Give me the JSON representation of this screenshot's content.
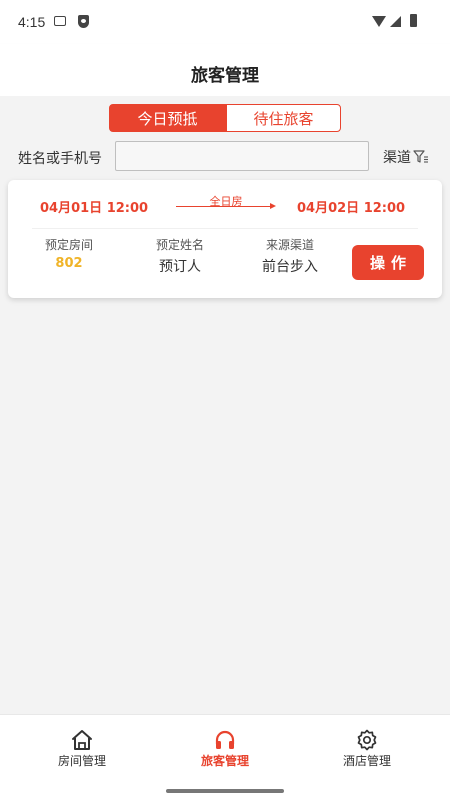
{
  "status_bar": {
    "time": "4:15"
  },
  "header": {
    "title": "旅客管理"
  },
  "tabs": [
    {
      "label": "今日预抵",
      "active": true
    },
    {
      "label": "待住旅客",
      "active": false
    }
  ],
  "search": {
    "label": "姓名或手机号",
    "value": "",
    "placeholder": ""
  },
  "filter": {
    "label": "渠道",
    "icon": "filter-icon"
  },
  "reservation": {
    "checkin": "04月01日 12:00",
    "checkout": "04月02日 12:00",
    "room_type": "全日房",
    "room_label": "预定房间",
    "room_number": "802",
    "name_label": "预定姓名",
    "name_value": "预订人",
    "source_label": "来源渠道",
    "source_value": "前台步入",
    "action_label": "操作"
  },
  "nav": [
    {
      "label": "房间管理",
      "icon": "home-icon",
      "active": false
    },
    {
      "label": "旅客管理",
      "icon": "headphones-icon",
      "active": true
    },
    {
      "label": "酒店管理",
      "icon": "gear-icon",
      "active": false
    }
  ],
  "colors": {
    "accent": "#e8432e",
    "room_number": "#f0b429",
    "background": "#f3f3f3"
  }
}
